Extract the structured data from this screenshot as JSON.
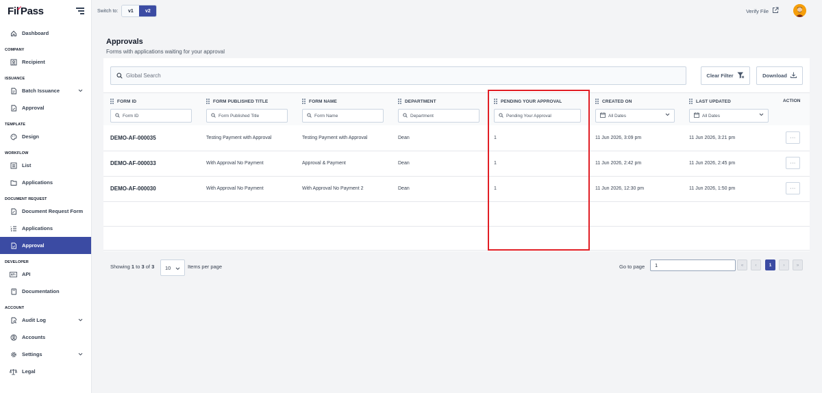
{
  "app": {
    "logo_prefix": "Fil",
    "logo_suffix": "Pass"
  },
  "topbar": {
    "switch_label": "Switch to:",
    "v1": "v1",
    "v2": "v2",
    "verify_file": "Verify File"
  },
  "sidebar": {
    "dashboard": "Dashboard",
    "sec_company": "COMPANY",
    "recipient": "Recipient",
    "sec_issuance": "ISSUANCE",
    "batch_issuance": "Batch Issuance",
    "approval_issuance": "Approval",
    "sec_template": "TEMPLATE",
    "design": "Design",
    "sec_workflow": "WORKFLOW",
    "list": "List",
    "applications_workflow": "Applications",
    "sec_docreq": "DOCUMENT REQUEST",
    "doc_request_form": "Document Request Form",
    "applications_docreq": "Applications",
    "approval_docreq": "Approval",
    "sec_developer": "DEVELOPER",
    "api": "API",
    "documentation": "Documentation",
    "sec_account": "ACCOUNT",
    "audit_log": "Audit Log",
    "accounts": "Accounts",
    "settings": "Settings",
    "legal": "Legal"
  },
  "page": {
    "title": "Approvals",
    "subtitle": "Forms with applications waiting for your approval"
  },
  "toolbar": {
    "search_placeholder": "Global Search",
    "clear_filter": "Clear Filter",
    "download": "Download"
  },
  "table": {
    "headers": {
      "form_id": "FORM ID",
      "published_title": "FORM PUBLISHED TITLE",
      "form_name": "FORM NAME",
      "department": "DEPARTMENT",
      "pending": "PENDING YOUR APPROVAL",
      "created_on": "CREATED ON",
      "last_updated": "LAST UPDATED",
      "action": "ACTION"
    },
    "filters": {
      "form_id": "Form ID",
      "published_title": "Form Published Title",
      "form_name": "Form Name",
      "department": "Department",
      "pending": "Pending Your Approval",
      "created_on": "All Dates",
      "last_updated": "All Dates"
    },
    "rows": [
      {
        "form_id": "DEMO-AF-000035",
        "published_title": "Testing Payment with Approval",
        "form_name": "Testing Payment with Approval",
        "department": "Dean",
        "pending": "1",
        "created_on": "11 Jun 2026, 3:09 pm",
        "last_updated": "11 Jun 2026, 3:21 pm",
        "action": "···"
      },
      {
        "form_id": "DEMO-AF-000033",
        "published_title": "With Approval No Payment",
        "form_name": "Approval & Payment",
        "department": "Dean",
        "pending": "1",
        "created_on": "11 Jun 2026, 2:42 pm",
        "last_updated": "11 Jun 2026, 2:45 pm",
        "action": "···"
      },
      {
        "form_id": "DEMO-AF-000030",
        "published_title": "With Approval No Payment",
        "form_name": "With Approval No Payment 2",
        "department": "Dean",
        "pending": "1",
        "created_on": "11 Jun 2026, 12:30 pm",
        "last_updated": "11 Jun 2026, 1:50 pm",
        "action": "···"
      }
    ]
  },
  "footer": {
    "showing_prefix": "Showing",
    "showing_from": "1",
    "showing_to_word": "to",
    "showing_to": "3",
    "showing_of_word": "of",
    "showing_total": "3",
    "per_page_value": "10",
    "per_page_label": "Items per page",
    "goto_label": "Go to page",
    "goto_value": "1",
    "pages": {
      "first": "«",
      "prev": "‹",
      "current": "1",
      "next": "›",
      "last": "»"
    }
  },
  "colors": {
    "brand": "#3b4ba3",
    "highlight": "#e11d24",
    "logo_accent": "#e11d48"
  }
}
